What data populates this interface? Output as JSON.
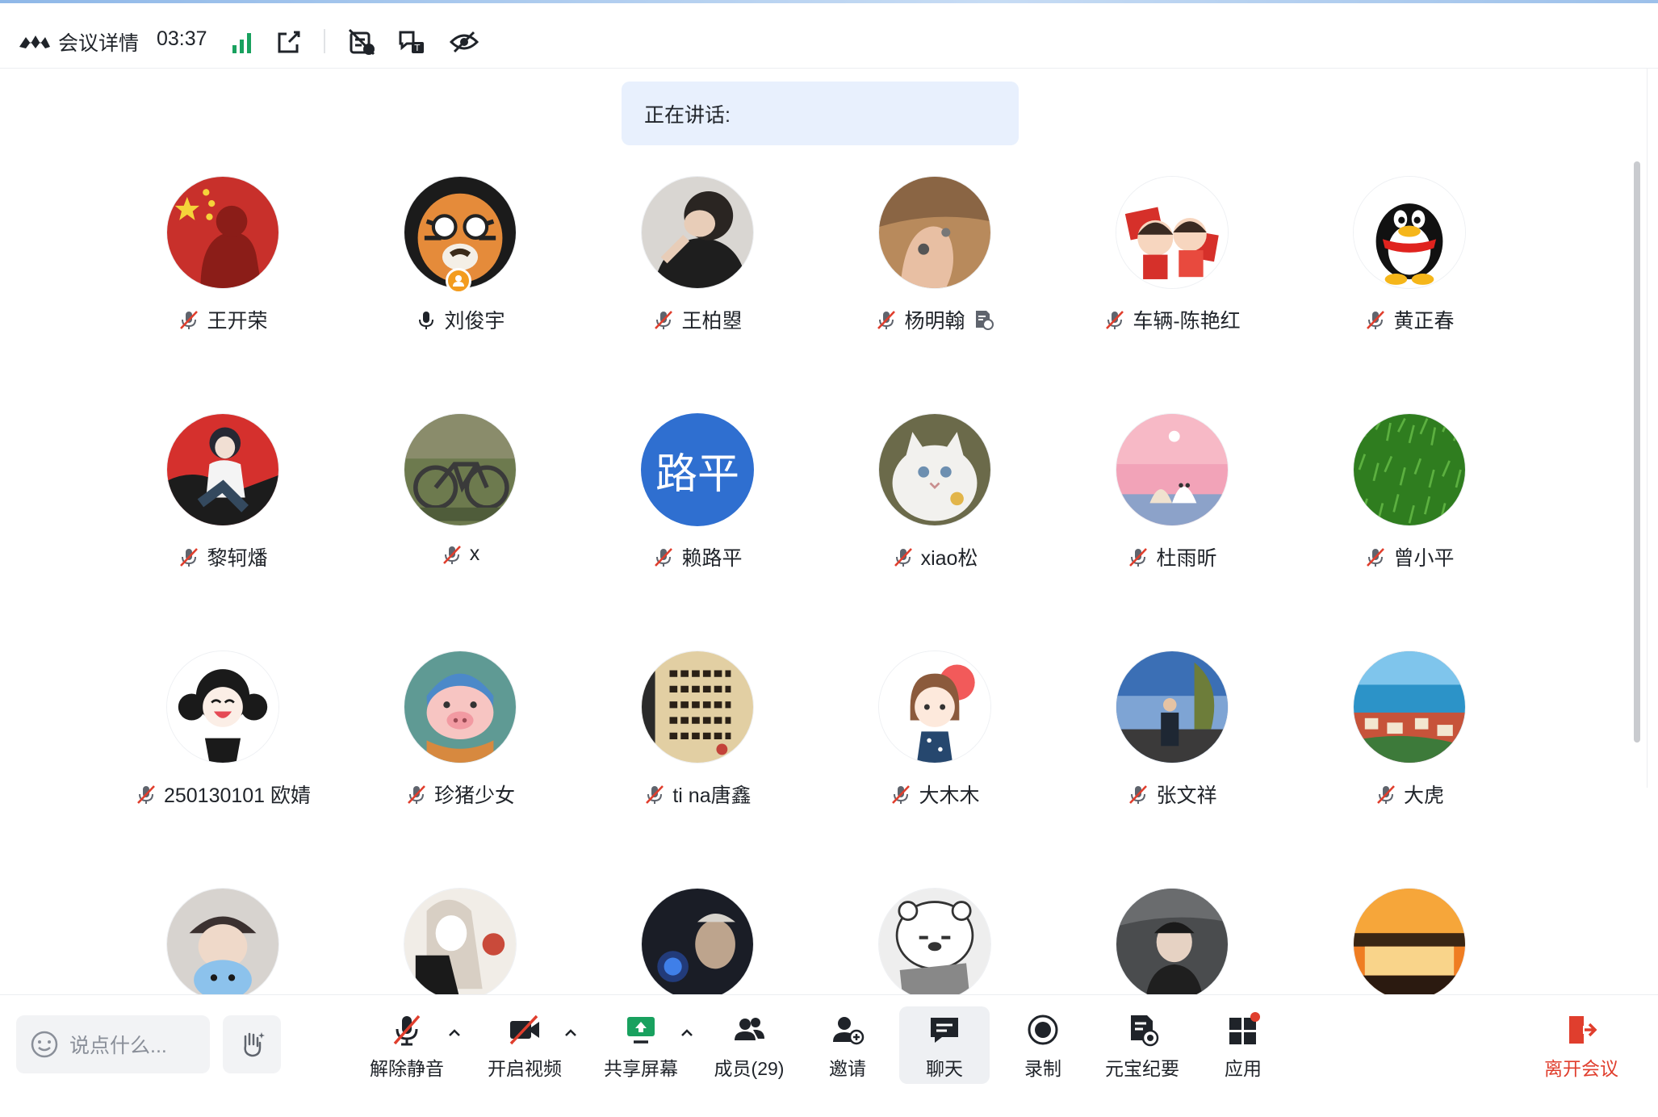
{
  "topbar": {
    "title": "会议详情",
    "timer": "03:37",
    "icons": [
      "signal-icon",
      "popout-icon",
      "captions-off-icon",
      "translate-icon",
      "hide-icon"
    ]
  },
  "speaking": {
    "label": "正在讲话:"
  },
  "participants": [
    {
      "name": "王开荣",
      "mic": "muted",
      "avatar": "red-flag-salute"
    },
    {
      "name": "刘俊宇",
      "mic": "on",
      "avatar": "tiger-glasses",
      "host": true
    },
    {
      "name": "王柏曌",
      "mic": "muted",
      "avatar": "boy-photo"
    },
    {
      "name": "杨明翰",
      "mic": "muted",
      "avatar": "hands-photo",
      "note": true
    },
    {
      "name": "车辆-陈艳红",
      "mic": "muted",
      "avatar": "cartoon-couple"
    },
    {
      "name": "黄正春",
      "mic": "muted",
      "avatar": "qq-penguin"
    },
    {
      "name": "黎轲燔",
      "mic": "muted",
      "avatar": "anime-boy"
    },
    {
      "name": "x",
      "mic": "muted",
      "avatar": "bicycle"
    },
    {
      "name": "赖路平",
      "mic": "muted",
      "avatar": "text",
      "avatar_text": "路平",
      "avatar_color": "#2f6fd0"
    },
    {
      "name": "xiao松",
      "mic": "muted",
      "avatar": "white-cat"
    },
    {
      "name": "杜雨昕",
      "mic": "muted",
      "avatar": "pink-sky"
    },
    {
      "name": "曾小平",
      "mic": "muted",
      "avatar": "grass"
    },
    {
      "name": "250130101 欧婧",
      "mic": "muted",
      "avatar": "laughing-girl"
    },
    {
      "name": "珍猪少女",
      "mic": "muted",
      "avatar": "pig-girl"
    },
    {
      "name": "ti na唐鑫",
      "mic": "muted",
      "avatar": "calligraphy"
    },
    {
      "name": "大木木",
      "mic": "muted",
      "avatar": "cartoon-girl"
    },
    {
      "name": "张文祥",
      "mic": "muted",
      "avatar": "lake-man"
    },
    {
      "name": "大虎",
      "mic": "muted",
      "avatar": "coastal-town"
    },
    {
      "name": "",
      "mic": "muted",
      "avatar": "girl-cat-hat"
    },
    {
      "name": "",
      "mic": "muted",
      "avatar": "anime-sketch"
    },
    {
      "name": "",
      "mic": "muted",
      "avatar": "dark-scene"
    },
    {
      "name": "",
      "mic": "muted",
      "avatar": "robot-bear"
    },
    {
      "name": "",
      "mic": "muted",
      "avatar": "car-man"
    },
    {
      "name": "",
      "mic": "muted",
      "avatar": "sunset"
    }
  ],
  "bottombar": {
    "chat_placeholder": "说点什么...",
    "unmute": "解除静音",
    "start_video": "开启视频",
    "share_screen": "共享屏幕",
    "members": "成员(29)",
    "invite": "邀请",
    "chat": "聊天",
    "record": "录制",
    "yuanbao": "元宝纪要",
    "apps": "应用",
    "leave": "离开会议"
  },
  "colors": {
    "accent": "#2f6fd0",
    "speaking_bg": "#e8f0fd",
    "leave_red": "#e03e2d",
    "share_green": "#19a15f",
    "signal_green": "#19a15f"
  }
}
